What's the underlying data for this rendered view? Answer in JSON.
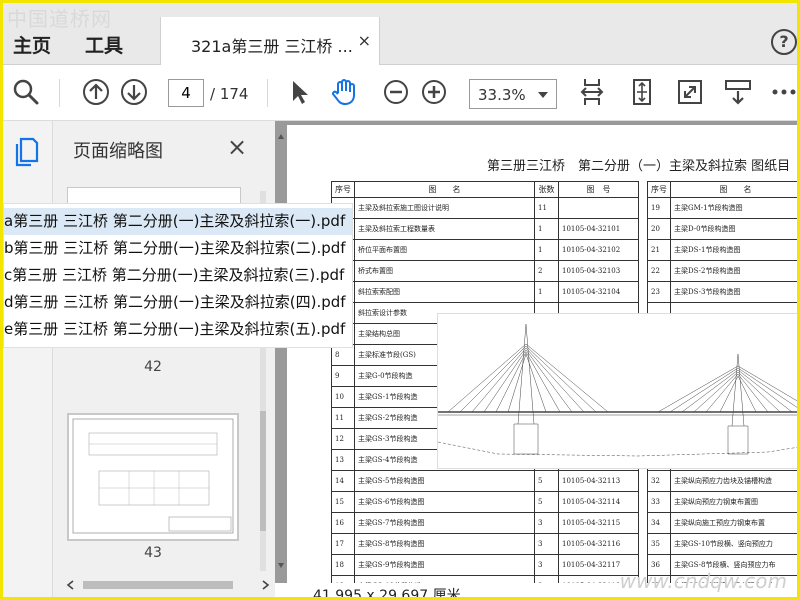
{
  "watermark": {
    "top": "中国道桥网",
    "bottom": "www.cndqw.com"
  },
  "tabs": {
    "home": "主页",
    "tools": "工具",
    "document": "321a第三册 三江桥 ...",
    "close": "×",
    "help": "?"
  },
  "toolbar": {
    "page_current": "4",
    "page_total": "/ 174",
    "zoom": "33.3%"
  },
  "panel": {
    "title": "页面缩略图",
    "close": "×",
    "page_numbers": [
      "42",
      "43"
    ]
  },
  "files": [
    "a第三册 三江桥 第二分册(一)主梁及斜拉索(一).pdf",
    "b第三册 三江桥 第二分册(一)主梁及斜拉索(二).pdf",
    "c第三册 三江桥 第二分册(一)主梁及斜拉索(三).pdf",
    "d第三册 三江桥 第二分册(一)主梁及斜拉索(四).pdf",
    "e第三册 三江桥 第二分册(一)主梁及斜拉索(五).pdf"
  ],
  "document": {
    "title": "第三册三江桥　第二分册（一）主梁及斜拉索 图纸目",
    "left_headers": [
      "序号",
      "图　　名",
      "张数",
      "图　号"
    ],
    "right_headers": [
      "序号",
      "图　　名"
    ],
    "left_rows": [
      [
        "1",
        "主梁及斜拉索施工图设计说明",
        "11",
        ""
      ],
      [
        "2",
        "主梁及斜拉索工程数量表",
        "1",
        "10105-04-32101"
      ],
      [
        "3",
        "桥位平面布置图",
        "1",
        "10105-04-32102"
      ],
      [
        "4",
        "桥式布置图",
        "2",
        "10105-04-32103"
      ],
      [
        "5",
        "斜拉索索配图",
        "1",
        "10105-04-32104"
      ],
      [
        "6",
        "斜拉索设计参数",
        "",
        ""
      ],
      [
        "7",
        "主梁结构总图",
        "",
        ""
      ],
      [
        "8",
        "主梁标准节段(GS)",
        "",
        ""
      ],
      [
        "9",
        "主梁G-0节段构造",
        "",
        ""
      ],
      [
        "10",
        "主梁GS-1节段构造",
        "",
        ""
      ],
      [
        "11",
        "主梁GS-2节段构造",
        "",
        ""
      ],
      [
        "12",
        "主梁GS-3节段构造",
        "",
        ""
      ],
      [
        "13",
        "主梁GS-4节段构造",
        "",
        ""
      ],
      [
        "14",
        "主梁GS-5节段构造图",
        "5",
        "10105-04-32113"
      ],
      [
        "15",
        "主梁GS-6节段构造图",
        "5",
        "10105-04-32114"
      ],
      [
        "16",
        "主梁GS-7节段构造图",
        "3",
        "10105-04-32115"
      ],
      [
        "17",
        "主梁GS-8节段构造图",
        "3",
        "10105-04-32116"
      ],
      [
        "18",
        "主梁GS-9节段构造图",
        "3",
        "10105-04-32117"
      ],
      [
        "19",
        "主梁GS-10节段构造",
        "3",
        "10105-04-32118"
      ]
    ],
    "right_rows": [
      [
        "19",
        "主梁GM-1节段构造图"
      ],
      [
        "20",
        "主梁D-0节段构造图"
      ],
      [
        "21",
        "主梁DS-1节段构造图"
      ],
      [
        "22",
        "主梁DS-2节段构造图"
      ],
      [
        "23",
        "主梁DS-3节段构造图"
      ],
      [
        "",
        ""
      ],
      [
        "",
        ""
      ],
      [
        "",
        ""
      ],
      [
        "",
        ""
      ],
      [
        "",
        ""
      ],
      [
        "",
        ""
      ],
      [
        "",
        ""
      ],
      [
        "",
        ""
      ],
      [
        "32",
        "主梁纵向预应力齿块及锚槽构造"
      ],
      [
        "33",
        "主梁纵向预应力钢束布置图"
      ],
      [
        "34",
        "主梁纵向施工预应力钢束布置"
      ],
      [
        "35",
        "主梁GS-10节段横、竖向预应力"
      ],
      [
        "36",
        "主梁GS-8节段横、竖向预应力布"
      ],
      [
        "37",
        "主梁GS-9节段横、竖向预应力布"
      ]
    ]
  },
  "status": {
    "page_size": "41.995 x 29.697 厘米"
  },
  "colors": {
    "accent": "#1473e6",
    "frame": "#f2e600"
  }
}
